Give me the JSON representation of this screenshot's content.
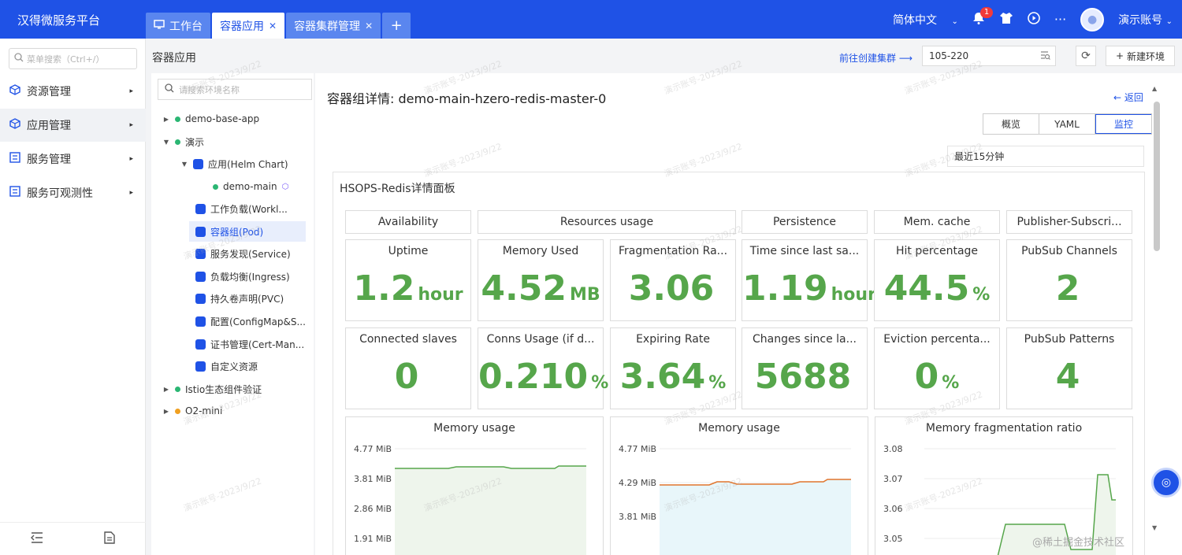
{
  "header": {
    "brand": "汉得微服务平台",
    "tabs": [
      {
        "label": "工作台",
        "active": false,
        "closable": false
      },
      {
        "label": "容器应用",
        "active": true,
        "closable": true
      },
      {
        "label": "容器集群管理",
        "active": false,
        "closable": true
      }
    ],
    "add_tab": "+",
    "language": "简体中文",
    "notification_count": "1",
    "account": "演示账号"
  },
  "sidebar": {
    "search_placeholder": "菜单搜索（Ctrl+/）",
    "items": [
      {
        "label": "资源管理"
      },
      {
        "label": "应用管理"
      },
      {
        "label": "服务管理"
      },
      {
        "label": "服务可观测性"
      }
    ]
  },
  "content": {
    "title": "容器应用",
    "goto_cluster": "前往创建集群 ⟶",
    "cluster_value": "105-220",
    "new_env": "新建环境"
  },
  "tree": {
    "search_placeholder": "请搜索环境名称",
    "nodes": [
      {
        "label": "demo-base-app"
      },
      {
        "label": "演示"
      },
      {
        "label": "应用(Helm Chart)"
      },
      {
        "label": "demo-main"
      },
      {
        "label": "工作负载(Workl..."
      },
      {
        "label": "容器组(Pod)"
      },
      {
        "label": "服务发现(Service)"
      },
      {
        "label": "负载均衡(Ingress)"
      },
      {
        "label": "持久卷声明(PVC)"
      },
      {
        "label": "配置(ConfigMap&S..."
      },
      {
        "label": "证书管理(Cert-Man..."
      },
      {
        "label": "自定义资源"
      },
      {
        "label": "Istio生态组件验证"
      },
      {
        "label": "O2-mini"
      }
    ]
  },
  "detail": {
    "title": "容器组详情: demo-main-hzero-redis-master-0",
    "back": "← 返回",
    "views": [
      "概览",
      "YAML",
      "监控"
    ],
    "time_range": "最近15分钟"
  },
  "dashboard": {
    "title": "HSOPS-Redis详情面板",
    "groups": [
      "Availability",
      "Resources usage",
      "Persistence",
      "Mem. cache",
      "Publisher-Subscri..."
    ],
    "stats_row1": [
      {
        "title": "Uptime",
        "value": "1.2",
        "unit": "hour"
      },
      {
        "title": "Memory Used",
        "value": "4.52",
        "unit": "MB"
      },
      {
        "title": "Fragmentation Ra...",
        "value": "3.06",
        "unit": ""
      },
      {
        "title": "Time since last sa...",
        "value": "1.19",
        "unit": "hour"
      },
      {
        "title": "Hit percentage",
        "value": "44.5",
        "unit": "%"
      },
      {
        "title": "PubSub Channels",
        "value": "2",
        "unit": ""
      }
    ],
    "stats_row2": [
      {
        "title": "Connected slaves",
        "value": "0",
        "unit": ""
      },
      {
        "title": "Conns Usage (if d...",
        "value": "0.210",
        "unit": "%"
      },
      {
        "title": "Expiring Rate",
        "value": "3.64",
        "unit": "%"
      },
      {
        "title": "Changes since la...",
        "value": "5688",
        "unit": ""
      },
      {
        "title": "Eviction percenta...",
        "value": "0",
        "unit": "%"
      },
      {
        "title": "PubSub Patterns",
        "value": "4",
        "unit": ""
      }
    ],
    "charts": [
      {
        "title": "Memory usage",
        "ticks": [
          "4.77 MiB",
          "3.81 MiB",
          "2.86 MiB",
          "1.91 MiB"
        ],
        "color": "#56a64b"
      },
      {
        "title": "Memory usage",
        "ticks": [
          "4.77 MiB",
          "4.29 MiB",
          "3.81 MiB"
        ],
        "color": "#e0752d"
      },
      {
        "title": "Memory fragmentation ratio",
        "ticks": [
          "3.08",
          "3.07",
          "3.06",
          "3.05"
        ],
        "color": "#56a64b"
      }
    ]
  },
  "watermark_footer": "@稀土掘金技术社区",
  "watermark_diag": "演示账号-2023/9/22",
  "colors": {
    "primary": "#1f52e6",
    "stat_green": "#56a64b"
  }
}
